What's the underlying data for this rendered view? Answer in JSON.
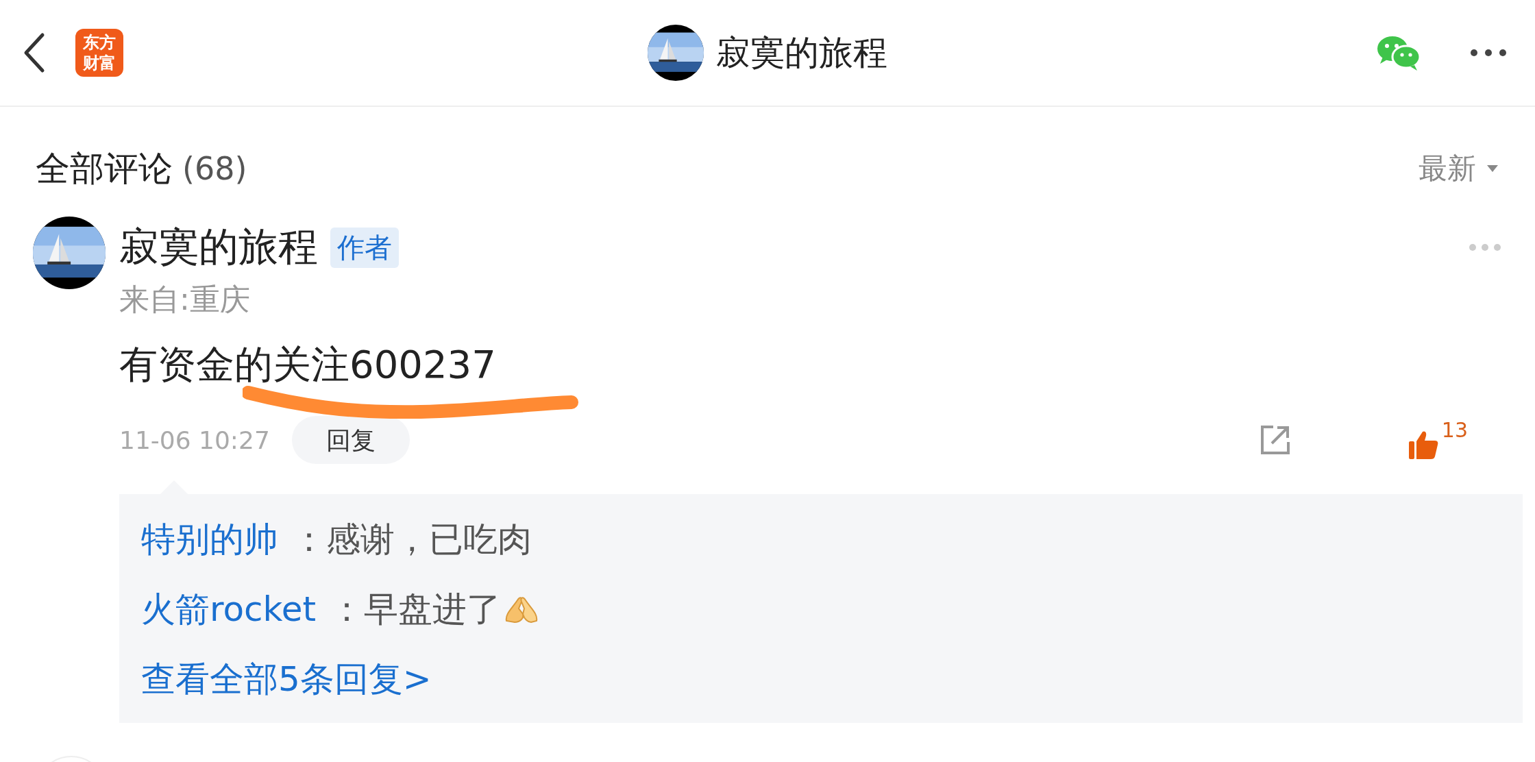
{
  "header": {
    "logo": [
      "东方",
      "财富"
    ],
    "title": "寂寞的旅程"
  },
  "comments_header": {
    "title": "全部评论",
    "count": "(68)",
    "sort": "最新"
  },
  "comment": {
    "author": "寂寞的旅程",
    "badge": "作者",
    "location": "来自:重庆",
    "text": "有资金的关注600237",
    "time": "11-06 10:27",
    "reply_button": "回复",
    "likes": "13",
    "liked": true,
    "replies": [
      {
        "name": "特别的帅",
        "text": "：感谢，已吃肉",
        "emoji": false
      },
      {
        "name": "火箭rocket",
        "text": "：早盘进了",
        "emoji": true
      }
    ],
    "view_all": "查看全部5条回复>"
  }
}
